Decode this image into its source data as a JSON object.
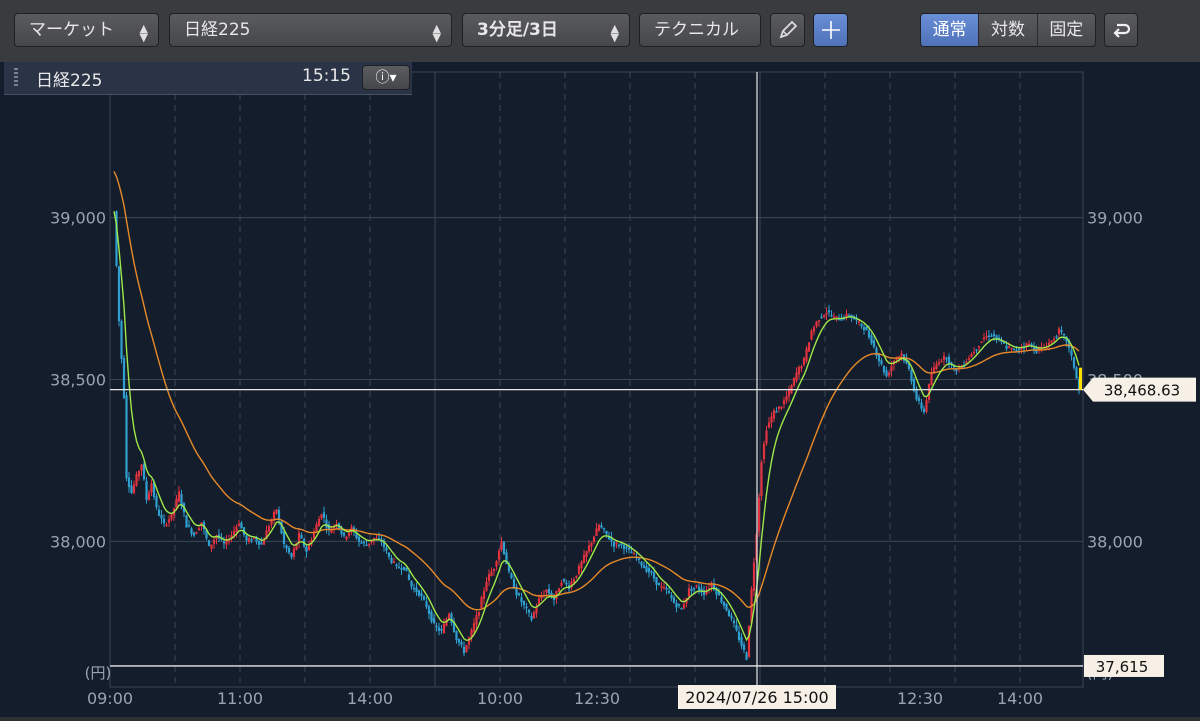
{
  "toolbar": {
    "market_select": "マーケット",
    "symbol_select": "日経225",
    "interval_select": "3分足/3日",
    "technical_button": "テクニカル",
    "scale_modes": [
      "通常",
      "対数",
      "固定"
    ],
    "active_scale_mode": "通常",
    "pencil_icon": "pencil-icon",
    "crosshair_icon": "crosshair-icon",
    "undo_icon": "undo-icon"
  },
  "info": {
    "symbol": "日経225",
    "time": "15:15",
    "info_icon": "info-icon"
  },
  "chart_data": {
    "type": "candlestick",
    "title": "",
    "x_tick_labels": [
      "09:00",
      "11:00",
      "14:00",
      "10:00",
      "12:30",
      "",
      "",
      "12:30",
      "14:00"
    ],
    "y_ticks": [
      38000,
      38500,
      39000
    ],
    "y_tick_labels": [
      "38,000",
      "38,500",
      "39,000"
    ],
    "yunit": "(円)",
    "ylim": [
      37550,
      39450
    ],
    "current_price_label": "38,468.63",
    "current_price": 38468.63,
    "low_label": "37,615",
    "low_price": 37615,
    "crosshair_date_label": "2024/07/26 15:00",
    "grid": true,
    "colors": {
      "up": "#e0333f",
      "down": "#2f9fd0",
      "ma_short": "#9ee84a",
      "ma_long": "#e88a2a",
      "background": "#141d2b",
      "grid": "#3a4556",
      "price_marker": "#ffe000"
    },
    "close_path": [
      [
        0,
        39020
      ],
      [
        2,
        38680
      ],
      [
        4,
        38450
      ],
      [
        5,
        38200
      ],
      [
        7,
        38150
      ],
      [
        9,
        38200
      ],
      [
        11,
        38240
      ],
      [
        13,
        38130
      ],
      [
        15,
        38180
      ],
      [
        17,
        38100
      ],
      [
        20,
        38050
      ],
      [
        23,
        38080
      ],
      [
        26,
        38150
      ],
      [
        29,
        38050
      ],
      [
        32,
        38020
      ],
      [
        35,
        38060
      ],
      [
        38,
        37980
      ],
      [
        41,
        38020
      ],
      [
        44,
        37990
      ],
      [
        47,
        38020
      ],
      [
        50,
        38060
      ],
      [
        53,
        38000
      ],
      [
        56,
        38010
      ],
      [
        59,
        37990
      ],
      [
        62,
        38050
      ],
      [
        65,
        38100
      ],
      [
        68,
        37990
      ],
      [
        71,
        37950
      ],
      [
        74,
        38020
      ],
      [
        77,
        37970
      ],
      [
        80,
        38030
      ],
      [
        83,
        38090
      ],
      [
        86,
        38030
      ],
      [
        89,
        38060
      ],
      [
        92,
        38010
      ],
      [
        95,
        38040
      ],
      [
        98,
        38000
      ],
      [
        101,
        37990
      ],
      [
        104,
        38010
      ],
      [
        107,
        38000
      ],
      [
        110,
        37950
      ],
      [
        113,
        37920
      ],
      [
        116,
        37920
      ],
      [
        119,
        37860
      ],
      [
        122,
        37840
      ],
      [
        125,
        37800
      ],
      [
        128,
        37740
      ],
      [
        131,
        37720
      ],
      [
        134,
        37780
      ],
      [
        137,
        37700
      ],
      [
        140,
        37660
      ],
      [
        143,
        37720
      ],
      [
        146,
        37790
      ],
      [
        149,
        37880
      ],
      [
        152,
        37920
      ],
      [
        155,
        38000
      ],
      [
        158,
        37900
      ],
      [
        161,
        37840
      ],
      [
        164,
        37800
      ],
      [
        167,
        37760
      ],
      [
        170,
        37820
      ],
      [
        173,
        37850
      ],
      [
        176,
        37820
      ],
      [
        179,
        37880
      ],
      [
        182,
        37860
      ],
      [
        185,
        37900
      ],
      [
        188,
        37950
      ],
      [
        191,
        38000
      ],
      [
        194,
        38050
      ],
      [
        197,
        38020
      ],
      [
        200,
        37990
      ],
      [
        203,
        37990
      ],
      [
        206,
        37970
      ],
      [
        209,
        37950
      ],
      [
        212,
        37920
      ],
      [
        215,
        37900
      ],
      [
        218,
        37860
      ],
      [
        221,
        37850
      ],
      [
        224,
        37810
      ],
      [
        227,
        37790
      ],
      [
        230,
        37850
      ],
      [
        233,
        37860
      ],
      [
        236,
        37840
      ],
      [
        239,
        37870
      ],
      [
        242,
        37830
      ],
      [
        245,
        37790
      ],
      [
        248,
        37740
      ],
      [
        251,
        37680
      ],
      [
        253,
        37640
      ],
      [
        255,
        37850
      ],
      [
        257,
        38030
      ],
      [
        259,
        38250
      ],
      [
        261,
        38350
      ],
      [
        264,
        38400
      ],
      [
        267,
        38420
      ],
      [
        270,
        38460
      ],
      [
        273,
        38520
      ],
      [
        276,
        38560
      ],
      [
        279,
        38650
      ],
      [
        282,
        38690
      ],
      [
        285,
        38710
      ],
      [
        288,
        38690
      ],
      [
        291,
        38690
      ],
      [
        294,
        38700
      ],
      [
        297,
        38680
      ],
      [
        300,
        38660
      ],
      [
        303,
        38620
      ],
      [
        306,
        38560
      ],
      [
        309,
        38510
      ],
      [
        312,
        38560
      ],
      [
        315,
        38580
      ],
      [
        318,
        38530
      ],
      [
        321,
        38440
      ],
      [
        324,
        38400
      ],
      [
        327,
        38520
      ],
      [
        330,
        38560
      ],
      [
        333,
        38570
      ],
      [
        336,
        38530
      ],
      [
        339,
        38540
      ],
      [
        342,
        38570
      ],
      [
        345,
        38600
      ],
      [
        348,
        38630
      ],
      [
        351,
        38640
      ],
      [
        354,
        38620
      ],
      [
        357,
        38600
      ],
      [
        360,
        38590
      ],
      [
        363,
        38600
      ],
      [
        366,
        38610
      ],
      [
        369,
        38590
      ],
      [
        372,
        38600
      ],
      [
        375,
        38620
      ],
      [
        378,
        38650
      ],
      [
        381,
        38620
      ],
      [
        384,
        38540
      ],
      [
        386,
        38468.63
      ]
    ]
  }
}
